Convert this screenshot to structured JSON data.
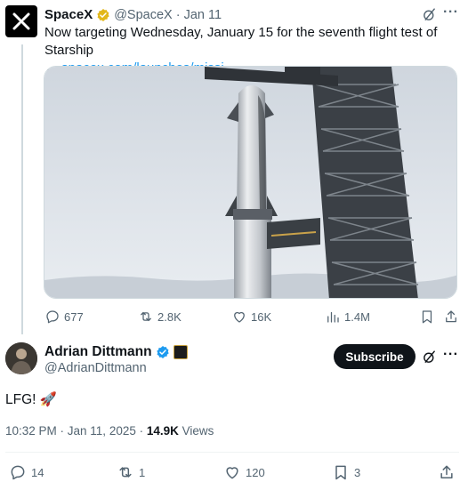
{
  "quoted_tweet": {
    "name": "SpaceX",
    "handle": "@SpaceX",
    "separator": "·",
    "date": "Jan 11",
    "text": "Now targeting Wednesday, January 15 for the seventh flight test of Starship",
    "link_arrow": "→",
    "link_text": "spacex.com/launches/missi…",
    "actions": {
      "replies": "677",
      "reposts": "2.8K",
      "likes": "16K",
      "views": "1.4M"
    },
    "more": "···"
  },
  "main_tweet": {
    "name": "Adrian Dittmann",
    "handle": "@AdrianDittmann",
    "subscribe_label": "Subscribe",
    "text": "LFG! 🚀",
    "time": "10:32 PM · Jan 11, 2025 ·",
    "views_count": "14.9K",
    "views_label": "Views",
    "more": "···",
    "actions": {
      "replies": "14",
      "reposts": "1",
      "likes": "120",
      "bookmarks": "3"
    }
  },
  "colors": {
    "verified_gold": "#e2b719",
    "verified_blue": "#1d9bf0",
    "link": "#1d9bf0",
    "muted": "#536471"
  }
}
